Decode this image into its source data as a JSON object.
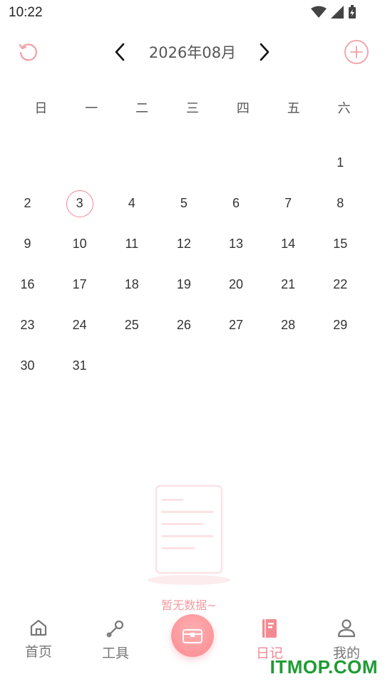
{
  "status": {
    "time": "10:22"
  },
  "header": {
    "month_title": "2026年08月"
  },
  "weekdays": [
    "日",
    "一",
    "二",
    "三",
    "四",
    "五",
    "六"
  ],
  "calendar": {
    "weeks": [
      [
        "",
        "",
        "",
        "",
        "",
        "",
        "1"
      ],
      [
        "2",
        "3",
        "4",
        "5",
        "6",
        "7",
        "8"
      ],
      [
        "9",
        "10",
        "11",
        "12",
        "13",
        "14",
        "15"
      ],
      [
        "16",
        "17",
        "18",
        "19",
        "20",
        "21",
        "22"
      ],
      [
        "23",
        "24",
        "25",
        "26",
        "27",
        "28",
        "29"
      ],
      [
        "30",
        "31",
        "",
        "",
        "",
        "",
        ""
      ]
    ],
    "selected_day": "3"
  },
  "empty_state": {
    "text": "暂无数据~"
  },
  "tabbar": {
    "home": "首页",
    "tools": "工具",
    "diary": "日记",
    "mine": "我的"
  },
  "watermark": "ITMOP.COM",
  "colors": {
    "accent": "#f28a93",
    "today_ring": "#f08a94"
  }
}
